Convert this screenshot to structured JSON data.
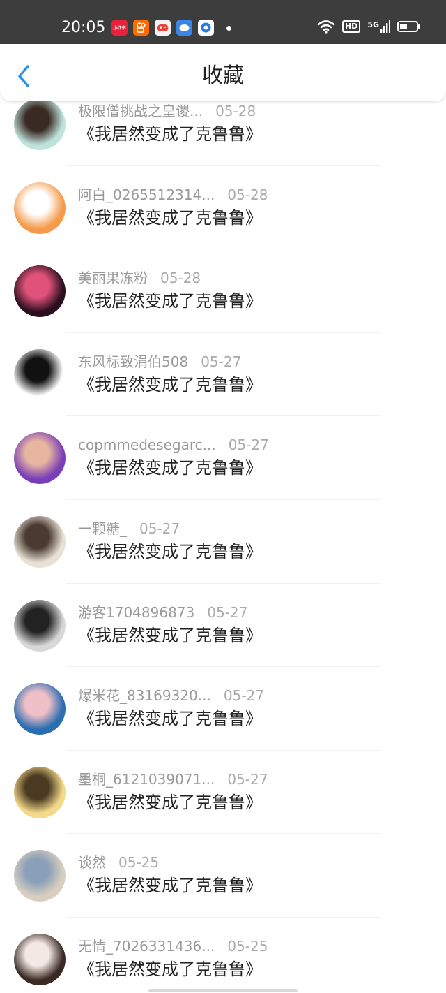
{
  "status_bar": {
    "time": "20:05",
    "app_icons": [
      {
        "name": "xiaohongshu-icon",
        "label": "小红书",
        "color": "#e8203a"
      },
      {
        "name": "kuaishou-icon",
        "label": "",
        "color": "#ff6a00"
      },
      {
        "name": "game-icon",
        "label": "",
        "color": "#f3f3f3"
      },
      {
        "name": "chat-icon",
        "label": "",
        "color": "#3a86e8"
      },
      {
        "name": "browser-icon",
        "label": "",
        "color": "#2d7ae0"
      }
    ],
    "hd_label": "HD",
    "network_label": "5G"
  },
  "header": {
    "title": "收藏"
  },
  "items": [
    {
      "user": "极限僧挑战之皇谡...",
      "date": "05-28",
      "title": "《我居然变成了克鲁鲁》",
      "avatar_colors": [
        "#bfe3dc",
        "#3a2a24"
      ]
    },
    {
      "user": "阿白_0265512314...",
      "date": "05-28",
      "title": "《我居然变成了克鲁鲁》",
      "avatar_colors": [
        "#f59a4a",
        "#ffffff"
      ]
    },
    {
      "user": "美丽果冻粉",
      "date": "05-28",
      "title": "《我居然变成了克鲁鲁》",
      "avatar_colors": [
        "#2a0f1e",
        "#e0527a"
      ]
    },
    {
      "user": "东风标致涓伯508",
      "date": "05-27",
      "title": "《我居然变成了克鲁鲁》",
      "avatar_colors": [
        "#ffffff",
        "#111111"
      ]
    },
    {
      "user": "copmmedesegarc...",
      "date": "05-27",
      "title": "《我居然变成了克鲁鲁》",
      "avatar_colors": [
        "#7a3fb8",
        "#e8b6a0"
      ]
    },
    {
      "user": "一颗糖_",
      "date": "05-27",
      "title": "《我居然变成了克鲁鲁》",
      "avatar_colors": [
        "#e9e1d6",
        "#4a3a32"
      ]
    },
    {
      "user": "游客1704896873",
      "date": "05-27",
      "title": "《我居然变成了克鲁鲁》",
      "avatar_colors": [
        "#d8d8d8",
        "#222222"
      ]
    },
    {
      "user": "爆米花_83169320...",
      "date": "05-27",
      "title": "《我居然变成了克鲁鲁》",
      "avatar_colors": [
        "#2a6db0",
        "#f0c0c8"
      ]
    },
    {
      "user": "墨桐_6121039071...",
      "date": "05-27",
      "title": "《我居然变成了克鲁鲁》",
      "avatar_colors": [
        "#f3d98a",
        "#4a3a22"
      ]
    },
    {
      "user": "谈然",
      "date": "05-25",
      "title": "《我居然变成了克鲁鲁》",
      "avatar_colors": [
        "#d8cfc0",
        "#8aa0b8"
      ]
    },
    {
      "user": "无情_7026331436...",
      "date": "05-25",
      "title": "《我居然变成了克鲁鲁》",
      "avatar_colors": [
        "#3a2a24",
        "#f4e8e4"
      ]
    }
  ]
}
